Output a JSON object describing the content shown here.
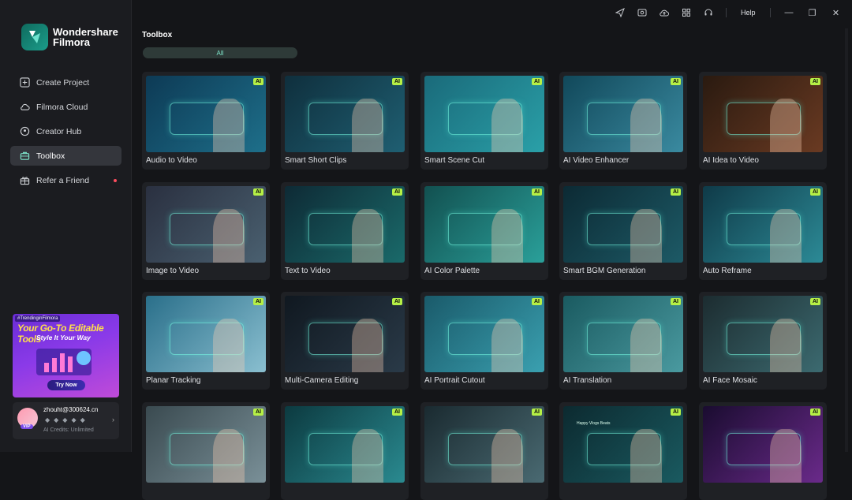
{
  "app": {
    "brand_line1": "Wondershare",
    "brand_line2": "Filmora"
  },
  "sidebar": {
    "items": [
      {
        "label": "Create Project",
        "icon": "plus-square-icon",
        "active": false
      },
      {
        "label": "Filmora Cloud",
        "icon": "cloud-icon",
        "active": false
      },
      {
        "label": "Creator Hub",
        "icon": "location-pin-icon",
        "active": false
      },
      {
        "label": "Toolbox",
        "icon": "toolbox-icon",
        "active": true
      },
      {
        "label": "Refer a Friend",
        "icon": "gift-icon",
        "active": false,
        "dot": true
      }
    ]
  },
  "promo": {
    "tag": "#TrendinginFilmora",
    "title": "Your Go-To Editable Tools",
    "subtitle": "Style It Your Way",
    "button": "Try Now"
  },
  "user": {
    "email": "zhouht@300624.cn",
    "badge": "VIP",
    "credits": "AI Credits: Unlimited"
  },
  "topbar": {
    "icons": [
      "send-icon",
      "media-icon",
      "cloud-upload-icon",
      "grid-icon",
      "headset-icon"
    ],
    "help": "Help",
    "window": {
      "minimize": "—",
      "restore": "❐",
      "close": "✕"
    }
  },
  "main": {
    "title": "Toolbox",
    "filter": "All",
    "ai_badge": "AI",
    "tools": [
      {
        "label": "Audio to Video",
        "c1": "#0d3a55",
        "c2": "#1e6f8a"
      },
      {
        "label": "Smart Short Clips",
        "c1": "#0f2f3d",
        "c2": "#1f5f72"
      },
      {
        "label": "Smart Scene Cut",
        "c1": "#1a6a7a",
        "c2": "#2aa0a8"
      },
      {
        "label": "AI Video Enhancer",
        "c1": "#11485a",
        "c2": "#3a8aa0"
      },
      {
        "label": "AI Idea to Video",
        "c1": "#2a1a10",
        "c2": "#6a3a22"
      },
      {
        "label": "Image to Video",
        "c1": "#2a3040",
        "c2": "#4a6070"
      },
      {
        "label": "Text to Video",
        "c1": "#0e2a35",
        "c2": "#1a6a6a"
      },
      {
        "label": "AI Color Palette",
        "c1": "#125050",
        "c2": "#2aa09a"
      },
      {
        "label": "Smart BGM Generation",
        "c1": "#0c2a34",
        "c2": "#1d5a66"
      },
      {
        "label": "Auto Reframe",
        "c1": "#0f3a48",
        "c2": "#2c8a96"
      },
      {
        "label": "Planar Tracking",
        "c1": "#2a6f8a",
        "c2": "#8abfd0"
      },
      {
        "label": "Multi-Camera Editing",
        "c1": "#101820",
        "c2": "#2a3a48"
      },
      {
        "label": "AI Portrait Cutout",
        "c1": "#1a5a6a",
        "c2": "#3aa0b0"
      },
      {
        "label": "AI Translation",
        "c1": "#1a5a60",
        "c2": "#4a9aa0"
      },
      {
        "label": "AI Face Mosaic",
        "c1": "#1c2c30",
        "c2": "#3c6a70"
      },
      {
        "label": "",
        "c1": "#3a4a50",
        "c2": "#7a9098"
      },
      {
        "label": "",
        "c1": "#0c3a40",
        "c2": "#2a8a90"
      },
      {
        "label": "",
        "c1": "#1a2a30",
        "c2": "#4a6a72"
      },
      {
        "label": "Happy Vlogs Beats",
        "c1": "#0c2a30",
        "c2": "#1a5a60"
      },
      {
        "label": "",
        "c1": "#1a0c30",
        "c2": "#6a2a8a"
      }
    ]
  }
}
